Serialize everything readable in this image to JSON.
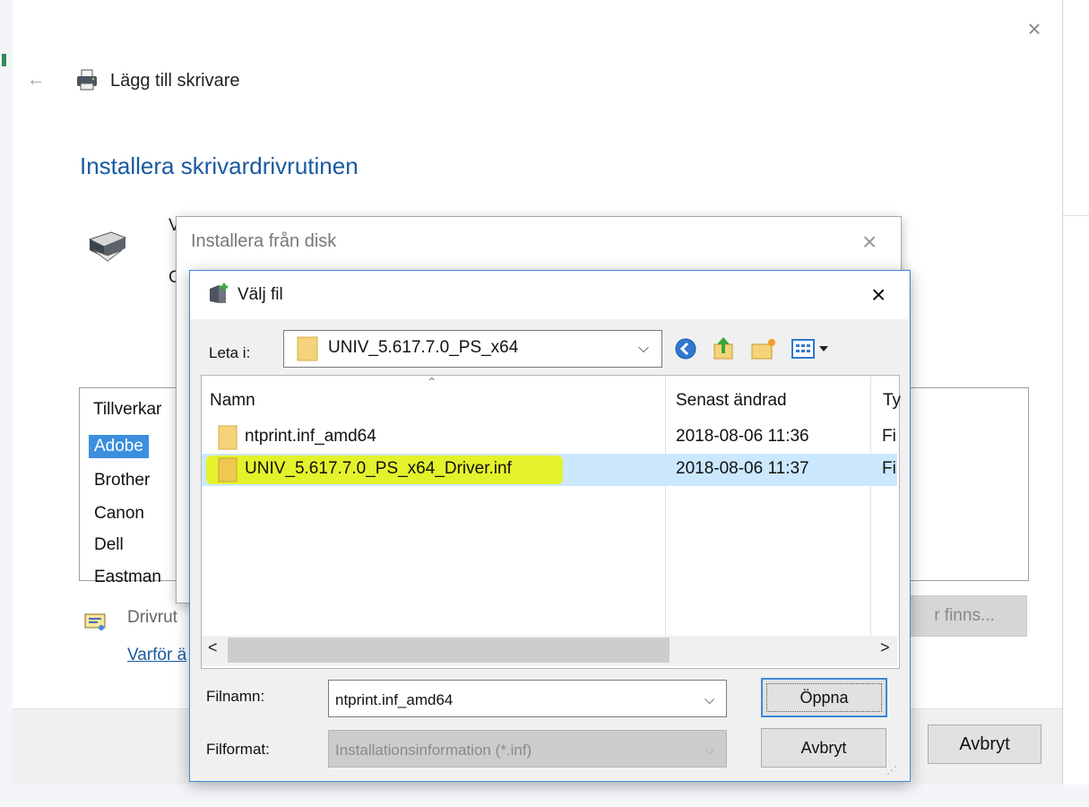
{
  "wizard": {
    "title": "Lägg till skrivare",
    "heading": "Installera skrivardrivrutinen",
    "partial_text_1": "V",
    "partial_text_2": "C",
    "manufacturer_header": "Tillverkar",
    "manufacturers": [
      "Adobe",
      "Brother",
      "Canon",
      "Dell",
      "Eastman"
    ],
    "selected_manufacturer": "Adobe",
    "cert_text": "Drivrut",
    "why_link": "Varför ä",
    "update_button": "r finns...",
    "cancel_button": "Avbryt"
  },
  "disk_dialog": {
    "title": "Installera från disk"
  },
  "file_dialog": {
    "title": "Välj fil",
    "look_in_label": "Leta i:",
    "look_in_value": "UNIV_5.617.7.0_PS_x64",
    "columns": {
      "name": "Namn",
      "date": "Senast ändrad",
      "type": "Ty"
    },
    "files": [
      {
        "name": "ntprint.inf_amd64",
        "date": "2018-08-06 11:36",
        "type": "Fi"
      },
      {
        "name": "UNIV_5.617.7.0_PS_x64_Driver.inf",
        "date": "2018-08-06 11:37",
        "type": "Fi"
      }
    ],
    "filename_label": "Filnamn:",
    "filename_value": "ntprint.inf_amd64",
    "filetype_label": "Filformat:",
    "filetype_value": "Installationsinformation (*.inf)",
    "open_button": "Öppna",
    "cancel_button": "Avbryt"
  },
  "icons": {
    "close": "close-icon",
    "back": "back-arrow-icon",
    "printer": "printer-icon",
    "folder": "folder-icon",
    "nav_back": "nav-back-icon",
    "up_folder": "up-folder-icon",
    "new_folder": "new-folder-icon",
    "view_menu": "view-menu-icon"
  },
  "colors": {
    "accent": "#1a5aa0",
    "selection": "#cce8ff",
    "highlight": "#e6f21a",
    "dialog_border": "#3b8ad8"
  }
}
